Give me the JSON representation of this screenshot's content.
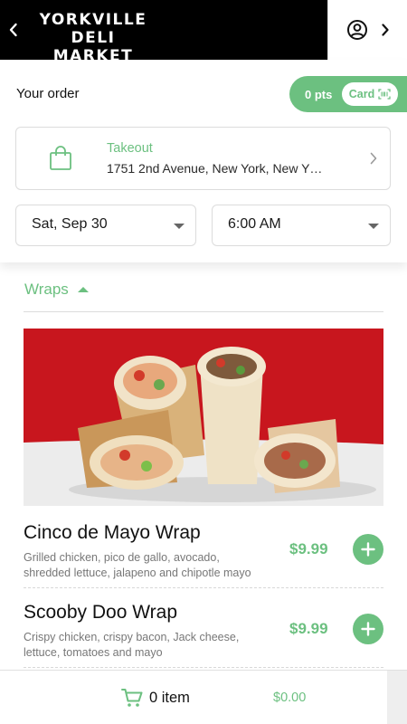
{
  "header": {
    "brand_line1": "YORKVILLE",
    "brand_line2": "DELI MARKET",
    "back_icon": "chevron-left-icon",
    "account_icon": "user-circle-icon",
    "account_chevron": "chevron-right-icon"
  },
  "order": {
    "title": "Your order",
    "points_label": "0 pts",
    "card_label": "Card",
    "fulfillment": {
      "type_label": "Takeout",
      "address": "1751 2nd Avenue, New York, New Y…"
    },
    "date_value": "Sat, Sep 30",
    "time_value": "6:00 AM"
  },
  "menu": {
    "section_title": "Wraps",
    "items": [
      {
        "name": "Cinco de Mayo Wrap",
        "description": "Grilled chicken, pico de gallo, avocado, shredded lettuce, jalapeno and chipotle mayo",
        "price": "$9.99"
      },
      {
        "name": "Scooby Doo Wrap",
        "description": "Crispy chicken, crispy bacon, Jack cheese, lettuce, tomatoes and mayo",
        "price": "$9.99"
      }
    ]
  },
  "cart": {
    "count_label": "0 item",
    "total": "$0.00"
  },
  "colors": {
    "accent": "#6cc080",
    "header_bg": "#000000",
    "hero_red": "#c8161e"
  }
}
